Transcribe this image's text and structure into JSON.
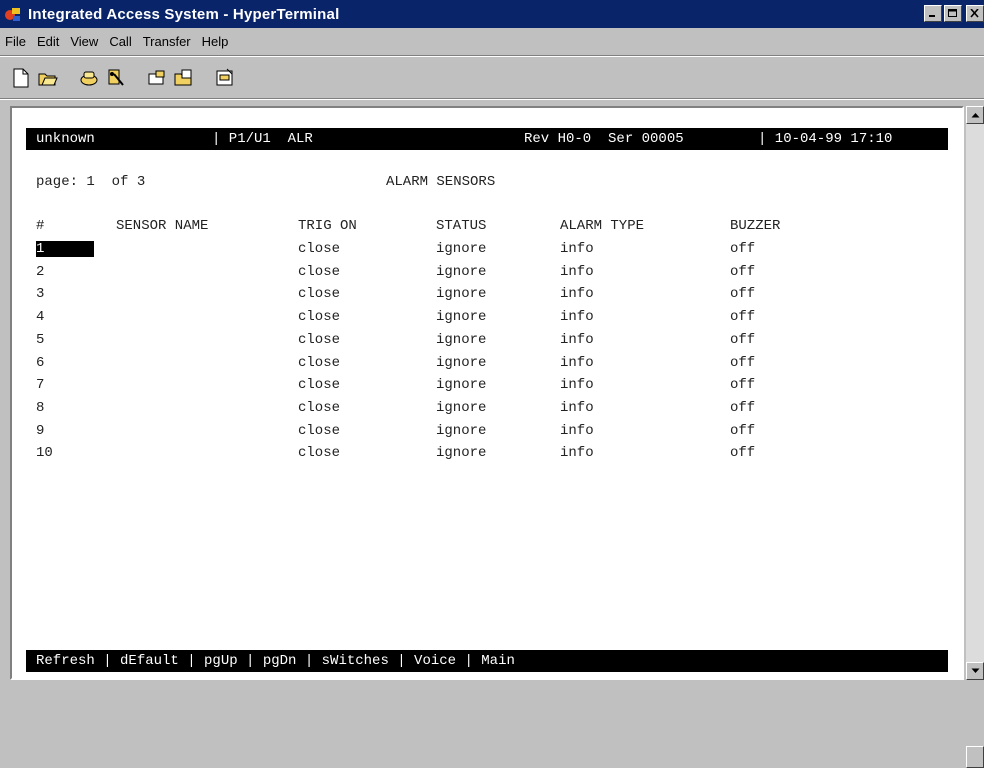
{
  "window": {
    "title": "Integrated Access System - HyperTerminal"
  },
  "menu": [
    "File",
    "Edit",
    "View",
    "Call",
    "Transfer",
    "Help"
  ],
  "toolbar": {
    "icons": [
      "new-icon",
      "open-icon",
      "connect-icon",
      "disconnect-icon",
      "send-icon",
      "receive-icon",
      "properties-icon"
    ]
  },
  "terminal": {
    "status": {
      "site": "unknown",
      "port": "| P1/U1  ALR",
      "rev": "Rev H0-0  Ser 00005",
      "datetime": "| 10-04-99 17:10"
    },
    "page_label": "page: 1  of 3",
    "screen_title": "ALARM SENSORS",
    "columns": [
      "#",
      "SENSOR NAME",
      "TRIG ON",
      "STATUS",
      "ALARM TYPE",
      "BUZZER"
    ],
    "rows": [
      {
        "num": "1",
        "name": "",
        "trig": "close",
        "status": "ignore",
        "type": "info",
        "buzzer": "off"
      },
      {
        "num": "2",
        "name": "",
        "trig": "close",
        "status": "ignore",
        "type": "info",
        "buzzer": "off"
      },
      {
        "num": "3",
        "name": "",
        "trig": "close",
        "status": "ignore",
        "type": "info",
        "buzzer": "off"
      },
      {
        "num": "4",
        "name": "",
        "trig": "close",
        "status": "ignore",
        "type": "info",
        "buzzer": "off"
      },
      {
        "num": "5",
        "name": "",
        "trig": "close",
        "status": "ignore",
        "type": "info",
        "buzzer": "off"
      },
      {
        "num": "6",
        "name": "",
        "trig": "close",
        "status": "ignore",
        "type": "info",
        "buzzer": "off"
      },
      {
        "num": "7",
        "name": "",
        "trig": "close",
        "status": "ignore",
        "type": "info",
        "buzzer": "off"
      },
      {
        "num": "8",
        "name": "",
        "trig": "close",
        "status": "ignore",
        "type": "info",
        "buzzer": "off"
      },
      {
        "num": "9",
        "name": "",
        "trig": "close",
        "status": "ignore",
        "type": "info",
        "buzzer": "off"
      },
      {
        "num": "10",
        "name": "",
        "trig": "close",
        "status": "ignore",
        "type": "info",
        "buzzer": "off"
      }
    ],
    "commands": "Refresh | dEfault | pgUp | pgDn | sWitches | Voice | Main"
  },
  "colors": {
    "titlebar": "#0a246a",
    "terminal_bg": "#ffffff",
    "bar_bg": "#000000"
  }
}
